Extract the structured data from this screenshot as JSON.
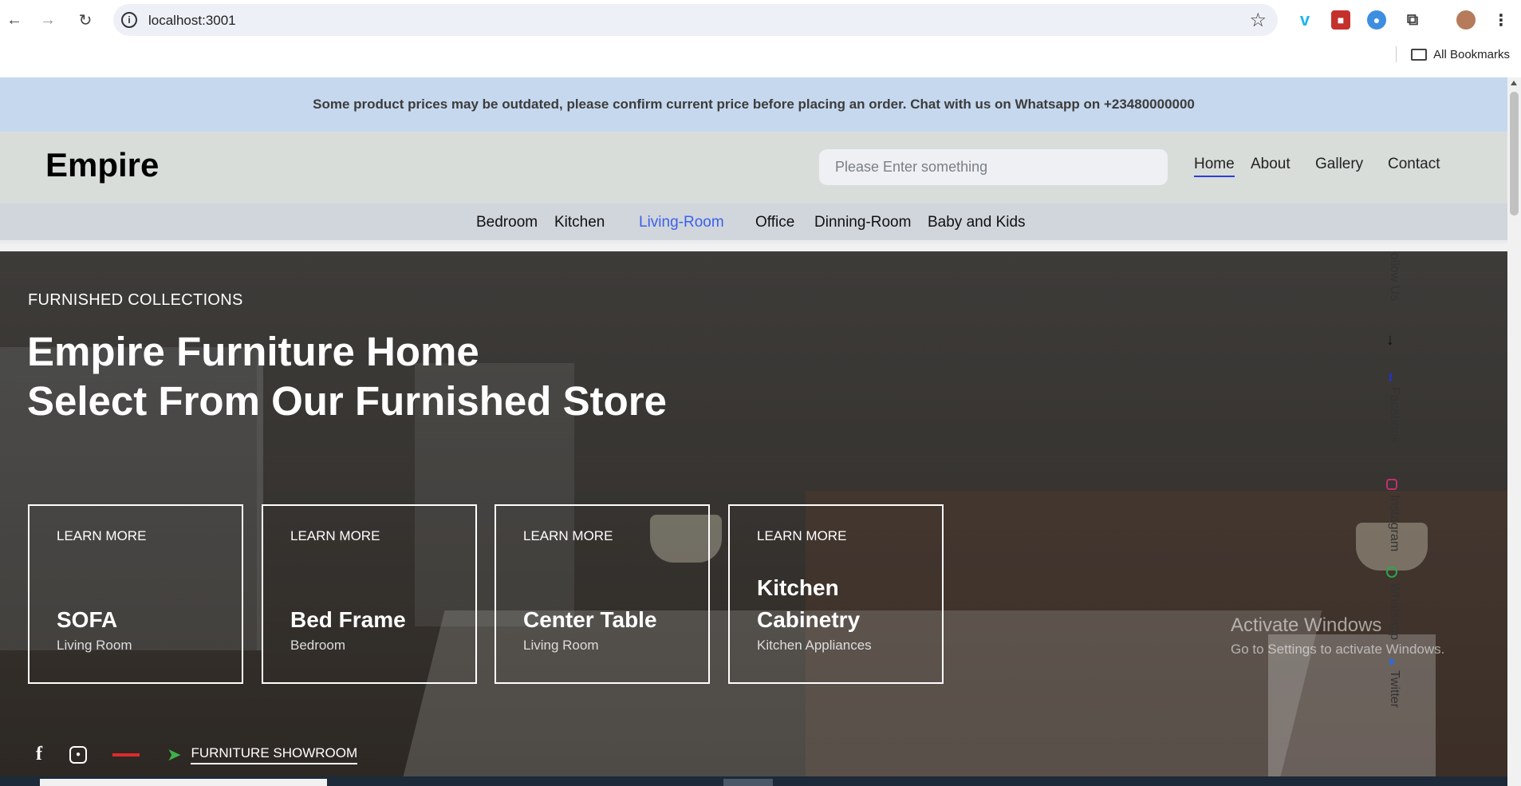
{
  "browser": {
    "url": "localhost:3001",
    "bookmarks_label": "All Bookmarks"
  },
  "notice": "Some product prices may be outdated, please confirm current price before placing an order. Chat with us on Whatsapp on +23480000000",
  "header": {
    "brand": "Empire",
    "search_placeholder": "Please Enter something",
    "nav": [
      "Home",
      "About",
      "Gallery",
      "Contact"
    ],
    "active_nav": "Home"
  },
  "categories": {
    "items": [
      "Bedroom",
      "Kitchen",
      "Living-Room",
      "Office",
      "Dinning-Room",
      "Baby and Kids"
    ],
    "active": "Living-Room"
  },
  "hero": {
    "eyebrow": "FURNISHED COLLECTIONS",
    "title_line1": "Empire Furniture Home",
    "title_line2": "Select From Our Furnished Store",
    "cards": [
      {
        "cta": "LEARN MORE",
        "name": "SOFA",
        "category": "Living Room"
      },
      {
        "cta": "LEARN MORE",
        "name": "Bed Frame",
        "category": "Bedroom"
      },
      {
        "cta": "LEARN MORE",
        "name": "Center Table",
        "category": "Living Room"
      },
      {
        "cta": "LEARN MORE",
        "name": "Kitchen Cabinetry",
        "category": "Kitchen Appliances"
      }
    ],
    "showroom_link": "FURNITURE SHOWROOM"
  },
  "follow": {
    "label": "Follow Us",
    "links": [
      "Facebook",
      "Instagram",
      "Whatsapp",
      "Twitter"
    ]
  },
  "watermark": {
    "line1": "Activate Windows",
    "line2": "Go to Settings to activate Windows."
  },
  "colors": {
    "notice_bg": "#c5d8ee",
    "header_bg": "#d9ddda",
    "category_bg": "#d1d5dc",
    "active_category": "#3a62e8",
    "nav_underline": "#2c3fd6"
  }
}
